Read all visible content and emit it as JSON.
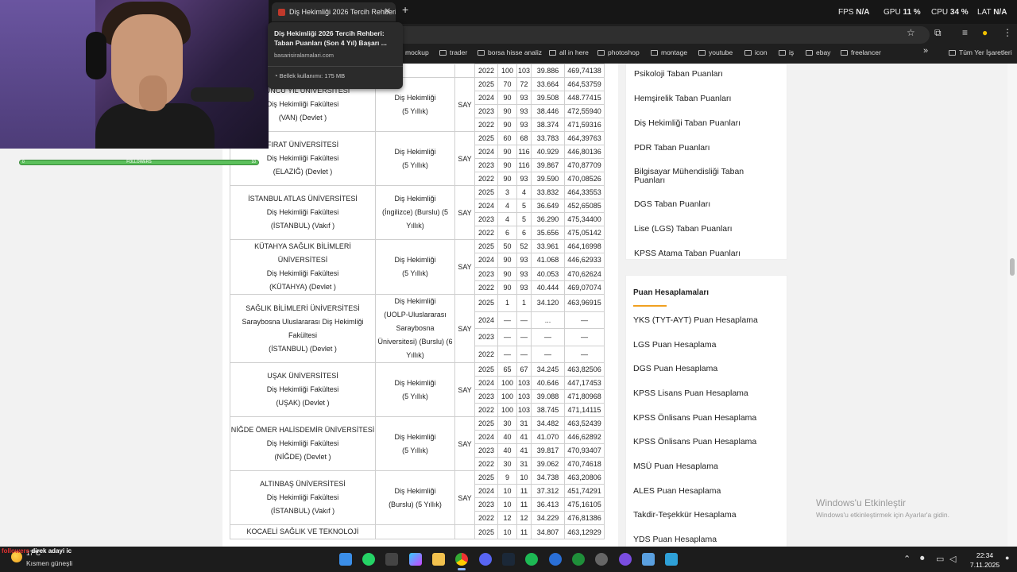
{
  "browser": {
    "tab_title": "Diş Hekimliği 2026 Tercih Rehberi",
    "tab_close": "✕",
    "new_tab": "+",
    "perf": {
      "fps_label": "FPS",
      "fps_value": "N/A",
      "gpu_label": "GPU",
      "gpu_value": "11 %",
      "cpu_label": "CPU",
      "cpu_value": "34 %",
      "lat_label": "LAT",
      "lat_value": "N/A"
    },
    "hover_card": {
      "title": "Diş Hekimliği 2026 Tercih Rehberi: Taban Puanları (Son 4 Yıl) Başarı ...",
      "domain": "basarisiralamalari.com",
      "memory": "Bellek kullanımı: 175 MB"
    },
    "bookmarks": [
      "mockup",
      "trader",
      "borsa hisse analiz",
      "all in here",
      "photoshop",
      "montage",
      "youtube",
      "icon",
      "iş",
      "ebay",
      "freelancer"
    ],
    "bookmarks_more": "»",
    "all_bookmarks": "Tüm Yer İşaretleri"
  },
  "webcam": {
    "follow_label": "FOLLOWERS",
    "follow_left": "0",
    "follow_right": "10"
  },
  "table": {
    "rows": [
      {
        "uni": [
          "ÜZÜNCÜ YIL ÜNİVERSİTESİ",
          "Diş Hekimliği Fakültesi",
          "(VAN) (Devlet )"
        ],
        "prog": [
          "Diş Hekimliği",
          "(5 Yıllık)"
        ],
        "type": "SAY",
        "years": [
          [
            "2025",
            "70",
            "72",
            "33.664",
            "464,53759"
          ],
          [
            "2024",
            "90",
            "93",
            "39.508",
            "448.77415"
          ],
          [
            "2023",
            "90",
            "93",
            "38.446",
            "472,55940"
          ],
          [
            "2022",
            "90",
            "93",
            "38.374",
            "471,59316"
          ]
        ]
      },
      {
        "uni": [
          "FIRAT ÜNİVERSİTESİ",
          "Diş Hekimliği Fakültesi",
          "(ELAZIĞ) (Devlet )"
        ],
        "prog": [
          "Diş Hekimliği",
          "(5 Yıllık)"
        ],
        "type": "SAY",
        "years": [
          [
            "2025",
            "60",
            "68",
            "33.783",
            "464,39763"
          ],
          [
            "2024",
            "90",
            "116",
            "40.929",
            "446,80136"
          ],
          [
            "2023",
            "90",
            "116",
            "39.867",
            "470,87709"
          ],
          [
            "2022",
            "90",
            "93",
            "39.590",
            "470,08526"
          ]
        ]
      },
      {
        "uni": [
          "İSTANBUL ATLAS ÜNİVERSİTESİ",
          "Diş Hekimliği Fakültesi",
          "(İSTANBUL) (Vakıf )"
        ],
        "prog": [
          "Diş Hekimliği",
          "(İngilizce) (Burslu) (5",
          "Yıllık)"
        ],
        "type": "SAY",
        "years": [
          [
            "2025",
            "3",
            "4",
            "33.832",
            "464,33553"
          ],
          [
            "2024",
            "4",
            "5",
            "36.649",
            "452,65085"
          ],
          [
            "2023",
            "4",
            "5",
            "36.290",
            "475,34400"
          ],
          [
            "2022",
            "6",
            "6",
            "35.656",
            "475,05142"
          ]
        ]
      },
      {
        "uni": [
          "KÜTAHYA SAĞLIK BİLİMLERİ ÜNİVERSİTESİ",
          "Diş Hekimliği Fakültesi",
          "(KÜTAHYA) (Devlet )"
        ],
        "prog": [
          "Diş Hekimliği",
          "(5 Yıllık)"
        ],
        "type": "SAY",
        "years": [
          [
            "2025",
            "50",
            "52",
            "33.961",
            "464,16998"
          ],
          [
            "2024",
            "90",
            "93",
            "41.068",
            "446,62933"
          ],
          [
            "2023",
            "90",
            "93",
            "40.053",
            "470,62624"
          ],
          [
            "2022",
            "90",
            "93",
            "40.444",
            "469,07074"
          ]
        ]
      },
      {
        "uni": [
          "SAĞLIK BİLİMLERİ ÜNİVERSİTESİ",
          "Saraybosna Uluslararası Diş Hekimliği",
          "Fakültesi",
          "(İSTANBUL) (Devlet )"
        ],
        "prog": [
          "Diş Hekimliği",
          "(UOLP-Uluslararası",
          "Saraybosna",
          "Üniversitesi) (Burslu) (6",
          "Yıllık)"
        ],
        "type": "SAY",
        "years": [
          [
            "2025",
            "1",
            "1",
            "34.120",
            "463,96915"
          ],
          [
            "2024",
            "—",
            "—",
            "...",
            "—"
          ],
          [
            "2023",
            "—",
            "—",
            "—",
            "—"
          ],
          [
            "2022",
            "—",
            "—",
            "—",
            "—"
          ]
        ]
      },
      {
        "uni": [
          "UŞAK ÜNİVERSİTESİ",
          "Diş Hekimliği Fakültesi",
          "(UŞAK) (Devlet )"
        ],
        "prog": [
          "Diş Hekimliği",
          "(5 Yıllık)"
        ],
        "type": "SAY",
        "years": [
          [
            "2025",
            "65",
            "67",
            "34.245",
            "463,82506"
          ],
          [
            "2024",
            "100",
            "103",
            "40.646",
            "447,17453"
          ],
          [
            "2023",
            "100",
            "103",
            "39.088",
            "471,80968"
          ],
          [
            "2022",
            "100",
            "103",
            "38.745",
            "471,14115"
          ]
        ]
      },
      {
        "uni": [
          "NİĞDE ÖMER HALİSDEMİR ÜNİVERSİTESİ",
          "Diş Hekimliği Fakültesi",
          "(NİĞDE) (Devlet )"
        ],
        "prog": [
          "Diş Hekimliği",
          "(5 Yıllık)"
        ],
        "type": "SAY",
        "years": [
          [
            "2025",
            "30",
            "31",
            "34.482",
            "463,52439"
          ],
          [
            "2024",
            "40",
            "41",
            "41.070",
            "446,62892"
          ],
          [
            "2023",
            "40",
            "41",
            "39.817",
            "470,93407"
          ],
          [
            "2022",
            "30",
            "31",
            "39.062",
            "470,74618"
          ]
        ]
      },
      {
        "uni": [
          "ALTINBAŞ ÜNİVERSİTESİ",
          "Diş Hekimliği Fakültesi",
          "(İSTANBUL) (Vakıf )"
        ],
        "prog": [
          "Diş Hekimliği",
          "(Burslu) (5 Yıllık)"
        ],
        "type": "SAY",
        "years": [
          [
            "2025",
            "9",
            "10",
            "34.738",
            "463,20806"
          ],
          [
            "2024",
            "10",
            "11",
            "37.312",
            "451,74291"
          ],
          [
            "2023",
            "10",
            "11",
            "36.413",
            "475,16105"
          ],
          [
            "2022",
            "12",
            "12",
            "34.229",
            "476,81386"
          ]
        ]
      },
      {
        "uni": [
          "KOCAELİ SAĞLIK VE TEKNOLOJİ"
        ],
        "prog": [
          ""
        ],
        "type": "",
        "years": [
          [
            "2025",
            "10",
            "11",
            "34.807",
            "463,12929"
          ]
        ]
      }
    ],
    "top_partial": [
      "2022",
      "100",
      "103",
      "39.886",
      "469,74138"
    ]
  },
  "sidebar": {
    "score_links": [
      "Psikoloji Taban Puanları",
      "Hemşirelik Taban Puanları",
      "Diş Hekimliği Taban Puanları",
      "PDR Taban Puanları",
      "Bilgisayar Mühendisliği Taban Puanları",
      "DGS Taban Puanları",
      "Lise (LGS) Taban Puanları",
      "KPSS Atama Taban Puanları"
    ],
    "calc_title": "Puan Hesaplamaları",
    "calc_links": [
      "YKS (TYT-AYT) Puan Hesaplama",
      "LGS Puan Hesaplama",
      "DGS Puan Hesaplama",
      "KPSS Lisans Puan Hesaplama",
      "KPSS Önlisans Puan Hesaplama",
      "KPSS Önlisans Puan Hesaplama",
      "MSÜ Puan Hesaplama",
      "ALES Puan Hesaplama",
      "Takdir-Teşekkür Hesaplama",
      "YDS Puan Hesaplama"
    ]
  },
  "watermark": {
    "title": "Windows'u Etkinleştir",
    "sub": "Windows'u etkinleştirmek için Ayarlar'a gidin."
  },
  "taskbar": {
    "notif_prefix": "followers",
    "notif_text": "direk adayi ic",
    "temp": "17°C",
    "weather": "Kısmen güneşli",
    "time": "22:34",
    "date": "7.11.2025"
  }
}
